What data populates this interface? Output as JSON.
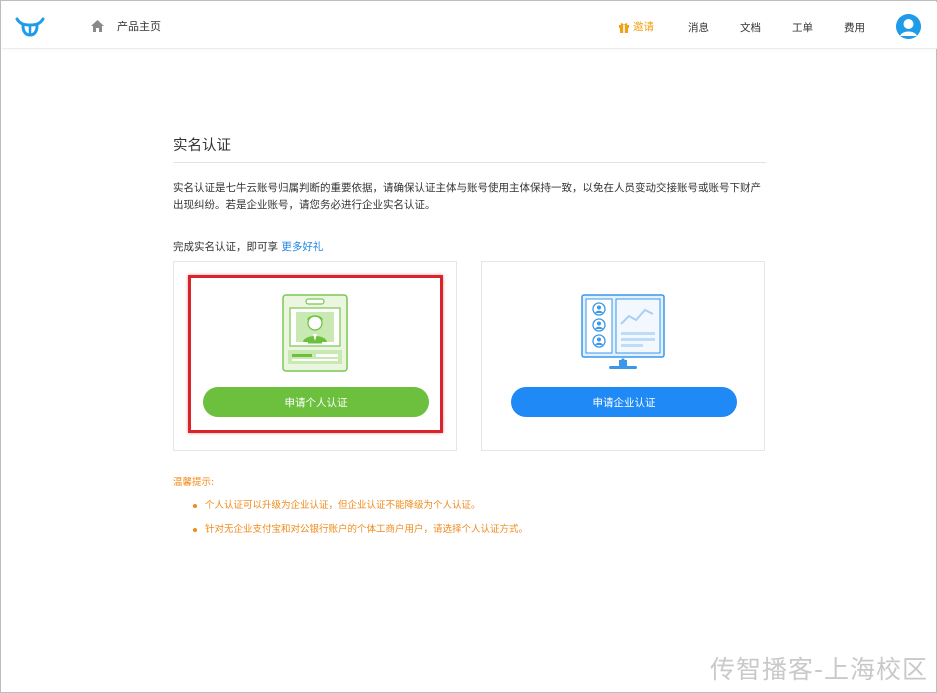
{
  "header": {
    "home_label": "产品主页",
    "nav": {
      "invite": "邀请",
      "messages": "消息",
      "docs": "文档",
      "ticket": "工单",
      "billing": "费用"
    }
  },
  "main": {
    "title": "实名认证",
    "intro": "实名认证是七牛云账号归属判断的重要依据，请确保认证主体与账号使用主体保持一致，以免在人员变动交接账号或账号下财产出现纠纷。若是企业账号，请您务必进行企业实名认证。",
    "gift_prefix": "完成实名认证，即可享",
    "gift_link": "更多好礼",
    "cards": {
      "personal_button": "申请个人认证",
      "enterprise_button": "申请企业认证"
    },
    "tips": {
      "title": "温馨提示:",
      "items": [
        "个人认证可以升级为企业认证，但企业认证不能降级为个人认证。",
        "针对无企业支付宝和对公银行账户的个体工商户用户，请选择个人认证方式。"
      ]
    }
  },
  "watermark": "传智播客-上海校区",
  "colors": {
    "brand_blue": "#1f9bea",
    "green": "#6cc03d",
    "blue": "#1f8af5",
    "tip_orange": "#f08a1a",
    "invite_orange": "#f2a116",
    "highlight_red": "#d9242b"
  }
}
